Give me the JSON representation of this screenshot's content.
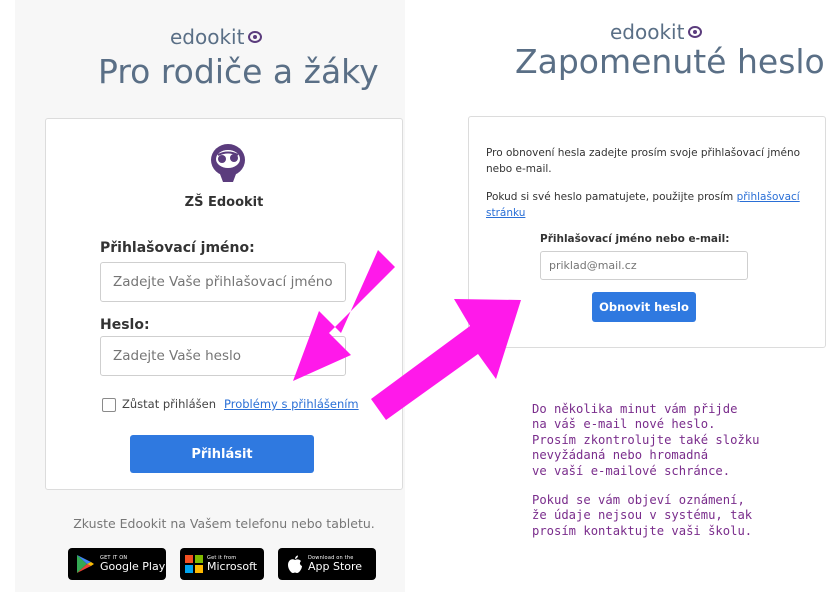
{
  "left": {
    "brand": "edookit",
    "title": "Pro rodiče a žáky",
    "school_name": "ZŠ Edookit",
    "username_label": "Přihlašovací jméno:",
    "username_placeholder": "Zadejte Vaše přihlašovací jméno",
    "password_label": "Heslo:",
    "password_placeholder": "Zadejte Vaše heslo",
    "remember_label": "Zůstat přihlášen",
    "problems_link": "Problémy s přihlášením",
    "login_button": "Přihlásit",
    "try_text": "Zkuste Edookit na Vašem telefonu nebo tabletu."
  },
  "stores": {
    "google": {
      "small": "GET IT ON",
      "big": "Google Play"
    },
    "microsoft": {
      "small": "Get it from",
      "big": "Microsoft"
    },
    "apple": {
      "small": "Download on the",
      "big": "App Store"
    }
  },
  "right": {
    "brand": "edookit",
    "title": "Zapomenuté heslo",
    "instruction1": "Pro obnovení hesla zadejte prosím svoje přihlašovací jméno nebo e-mail.",
    "instruction2_prefix": "Pokud si své heslo pamatujete, použijte prosím ",
    "instruction2_link": "přihlašovací stránku",
    "email_label": "Přihlašovací jméno nebo e-mail:",
    "email_placeholder": "priklad@mail.cz",
    "reset_button": "Obnovit heslo"
  },
  "note": {
    "paragraph1": "Do několika minut vám přijde\nna váš e-mail nové heslo.\nProsím zkontrolujte také složku\nnevyžádaná nebo hromadná\nve vaší e-mailové schránce.",
    "paragraph2": "Pokud se vám objeví oznámení,\nže údaje nejsou v systému, tak\nprosím kontaktujte vaši školu."
  },
  "colors": {
    "primary": "#2f79e0",
    "brand_text": "#5a6f86",
    "owl": "#5b3c7d",
    "arrow": "#ff19ea",
    "note_text": "#7a2d8c"
  },
  "icons": [
    "owl-logo-icon",
    "google-play-icon",
    "microsoft-icon",
    "apple-icon"
  ]
}
